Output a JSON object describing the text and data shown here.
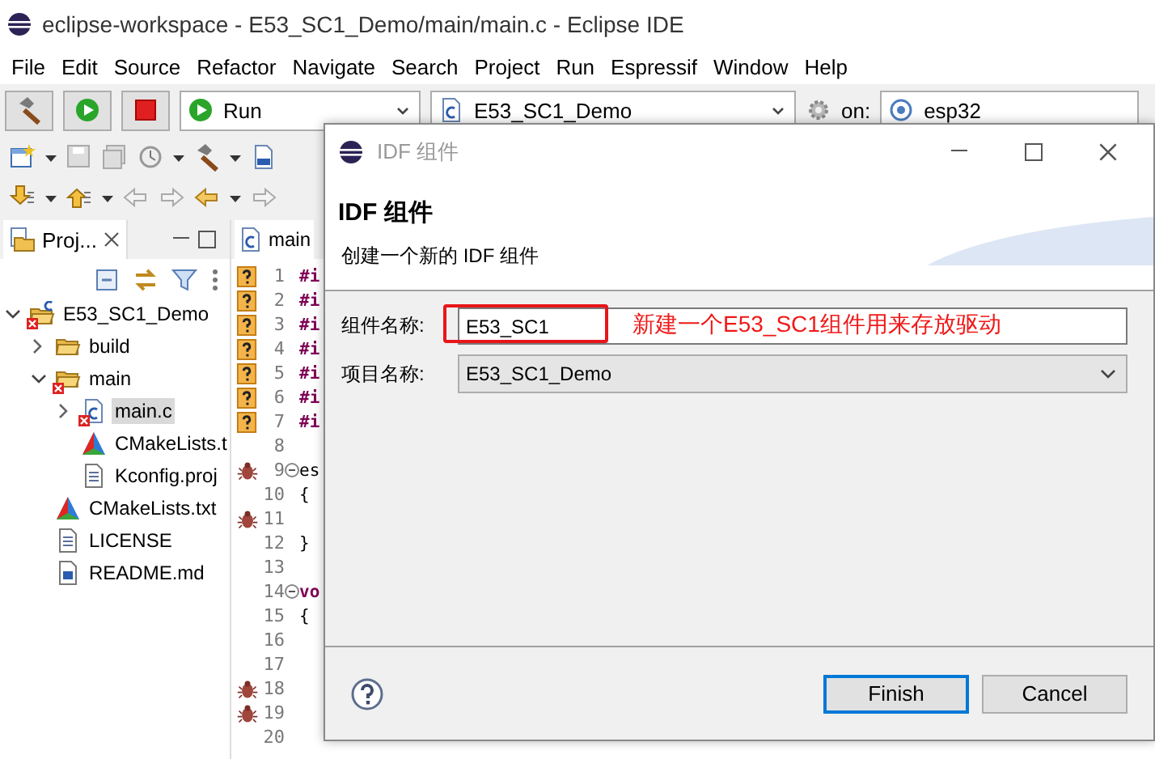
{
  "window": {
    "title": "eclipse-workspace - E53_SC1_Demo/main/main.c - Eclipse IDE"
  },
  "menu": [
    "File",
    "Edit",
    "Source",
    "Refactor",
    "Navigate",
    "Search",
    "Project",
    "Run",
    "Espressif",
    "Window",
    "Help"
  ],
  "toolbar": {
    "launch_mode": "Run",
    "launch_config": "E53_SC1_Demo",
    "target_label": "on:",
    "target": "esp32"
  },
  "project_explorer": {
    "tab": "Proj...",
    "tree": [
      {
        "label": "E53_SC1_Demo",
        "kind": "project",
        "error": true,
        "expanded": true,
        "selected": false,
        "children": [
          {
            "label": "build",
            "kind": "folder",
            "error": false,
            "expanded": false,
            "selected": false
          },
          {
            "label": "main",
            "kind": "folder",
            "error": true,
            "expanded": true,
            "selected": false,
            "children": [
              {
                "label": "main.c",
                "kind": "c-file",
                "error": true,
                "expanded": false,
                "selected": true
              },
              {
                "label": "CMakeLists.t",
                "kind": "cmake",
                "error": false,
                "selected": false
              },
              {
                "label": "Kconfig.proj",
                "kind": "text-file",
                "error": false,
                "selected": false
              }
            ]
          },
          {
            "label": "CMakeLists.txt",
            "kind": "cmake",
            "error": false,
            "selected": false
          },
          {
            "label": "LICENSE",
            "kind": "text-file",
            "error": false,
            "selected": false
          },
          {
            "label": "README.md",
            "kind": "word-file",
            "error": false,
            "selected": false
          }
        ]
      }
    ]
  },
  "editor": {
    "tab": "main",
    "lines": [
      {
        "number": "1",
        "code": "#i",
        "keyword": true,
        "kind": "warning",
        "fold": false
      },
      {
        "number": "2",
        "code": "#i",
        "keyword": true,
        "kind": "warning",
        "fold": false
      },
      {
        "number": "3",
        "code": "#i",
        "keyword": true,
        "kind": "warning",
        "fold": false
      },
      {
        "number": "4",
        "code": "#i",
        "keyword": true,
        "kind": "warning",
        "fold": false
      },
      {
        "number": "5",
        "code": "#i",
        "keyword": true,
        "kind": "warning",
        "fold": false
      },
      {
        "number": "6",
        "code": "#i",
        "keyword": true,
        "kind": "warning",
        "fold": false
      },
      {
        "number": "7",
        "code": "#i",
        "keyword": true,
        "kind": "warning",
        "fold": false
      },
      {
        "number": "8",
        "kind": "plain",
        "fold": false
      },
      {
        "number": "9",
        "code": "es",
        "keyword": false,
        "kind": "bug",
        "fold": true
      },
      {
        "number": "10",
        "code": "{",
        "keyword": false,
        "kind": "plain",
        "fold": false
      },
      {
        "number": "11",
        "kind": "bug",
        "fold": false
      },
      {
        "number": "12",
        "code": "}",
        "keyword": false,
        "kind": "plain",
        "fold": false
      },
      {
        "number": "13",
        "kind": "plain",
        "fold": false
      },
      {
        "number": "14",
        "code": "vo",
        "keyword": true,
        "kind": "plain",
        "fold": true
      },
      {
        "number": "15",
        "code": "{",
        "keyword": false,
        "kind": "plain",
        "fold": false
      },
      {
        "number": "16",
        "kind": "plain",
        "fold": false
      },
      {
        "number": "17",
        "kind": "plain",
        "fold": false
      },
      {
        "number": "18",
        "kind": "bug",
        "fold": false
      },
      {
        "number": "19",
        "kind": "bug",
        "fold": false
      },
      {
        "number": "20",
        "kind": "plain",
        "fold": false
      }
    ]
  },
  "dialog": {
    "title": "IDF 组件",
    "heading": "IDF 组件",
    "description": "创建一个新的 IDF 组件",
    "fields": [
      {
        "label": "组件名称:",
        "value": "E53_SC1",
        "kind": "text"
      },
      {
        "label": "项目名称:",
        "value": "E53_SC1_Demo",
        "kind": "combo"
      }
    ],
    "annotation": "新建一个E53_SC1组件用来存放驱动",
    "buttons": [
      {
        "label": "Finish",
        "default": true
      },
      {
        "label": "Cancel",
        "default": false
      }
    ]
  }
}
